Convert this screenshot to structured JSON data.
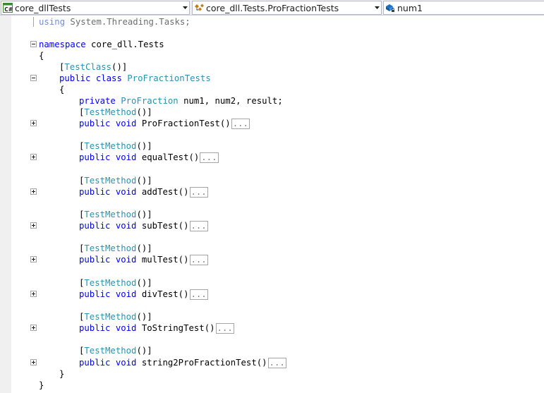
{
  "navbar": {
    "project_combo": {
      "value": "core_dllTests",
      "icon": "csharp-project-icon"
    },
    "class_combo": {
      "value": "core_dll.Tests.ProFractionTests",
      "icon": "class-icon"
    },
    "member_combo": {
      "value": "num1",
      "icon": "field-icon"
    }
  },
  "colors": {
    "keyword": "#0000ff",
    "type": "#2b91af",
    "plain": "#000000",
    "collapsed_hint": "#808080"
  },
  "code": {
    "using_line": {
      "keyword": "using",
      "rest": " System.Threading.Tasks;"
    },
    "namespace_line": {
      "keyword": "namespace",
      "name": " core_dll.Tests"
    },
    "open_brace": "{",
    "close_brace": "}",
    "class_attribute": {
      "open": "[",
      "name": "TestClass",
      "close": "()]"
    },
    "class_decl": {
      "modifier": "public",
      "keyword": "class",
      "name": "ProFractionTests"
    },
    "field_line": {
      "modifier": "private",
      "type": "ProFraction",
      "rest": " num1, num2, result;"
    },
    "collapsed_hint": "...",
    "method_attribute": {
      "open": "[",
      "name": "TestMethod",
      "close": "()]"
    },
    "methods": [
      {
        "modifier": "public",
        "ret": "void",
        "name": " ProFractionTest()"
      },
      {
        "modifier": "public",
        "ret": "void",
        "name": " equalTest()"
      },
      {
        "modifier": "public",
        "ret": "void",
        "name": " addTest()"
      },
      {
        "modifier": "public",
        "ret": "void",
        "name": " subTest()"
      },
      {
        "modifier": "public",
        "ret": "void",
        "name": " mulTest()"
      },
      {
        "modifier": "public",
        "ret": "void",
        "name": " divTest()"
      },
      {
        "modifier": "public",
        "ret": "void",
        "name": " ToStringTest()"
      },
      {
        "modifier": "public",
        "ret": "void",
        "name": " string2ProFractionTest()"
      }
    ]
  }
}
